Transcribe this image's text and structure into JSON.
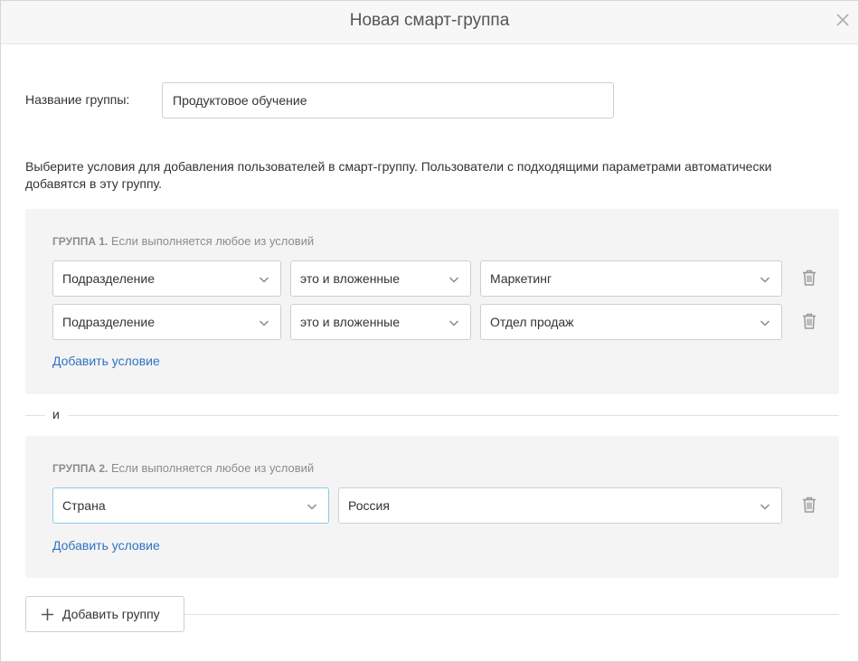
{
  "dialog": {
    "title": "Новая смарт-группа",
    "close_icon": "close-icon"
  },
  "name_field": {
    "label": "Название группы:",
    "value": "Продуктовое обучение"
  },
  "description": "Выберите условия для добавления пользователей в смарт-группу. Пользователи с подходящими параметрами автоматически добавятся в эту группу.",
  "groups": [
    {
      "title_bold": "ГРУППА 1.",
      "title_rest": " Если выполняется любое из условий",
      "conditions": [
        {
          "field": "Подразделение",
          "operator": "это и вложенные",
          "value": "Маркетинг"
        },
        {
          "field": "Подразделение",
          "operator": "это и вложенные",
          "value": "Отдел продаж"
        }
      ],
      "add_condition": "Добавить условие"
    },
    {
      "title_bold": "ГРУППА 2.",
      "title_rest": " Если выполняется любое из условий",
      "conditions": [
        {
          "field": "Страна",
          "value": "Россия"
        }
      ],
      "add_condition": "Добавить условие"
    }
  ],
  "and_label": "и",
  "add_group_label": "Добавить группу",
  "colors": {
    "link": "#2f73c0",
    "group_bg": "#f4f4f4",
    "focus_border": "#8cc8e8"
  }
}
